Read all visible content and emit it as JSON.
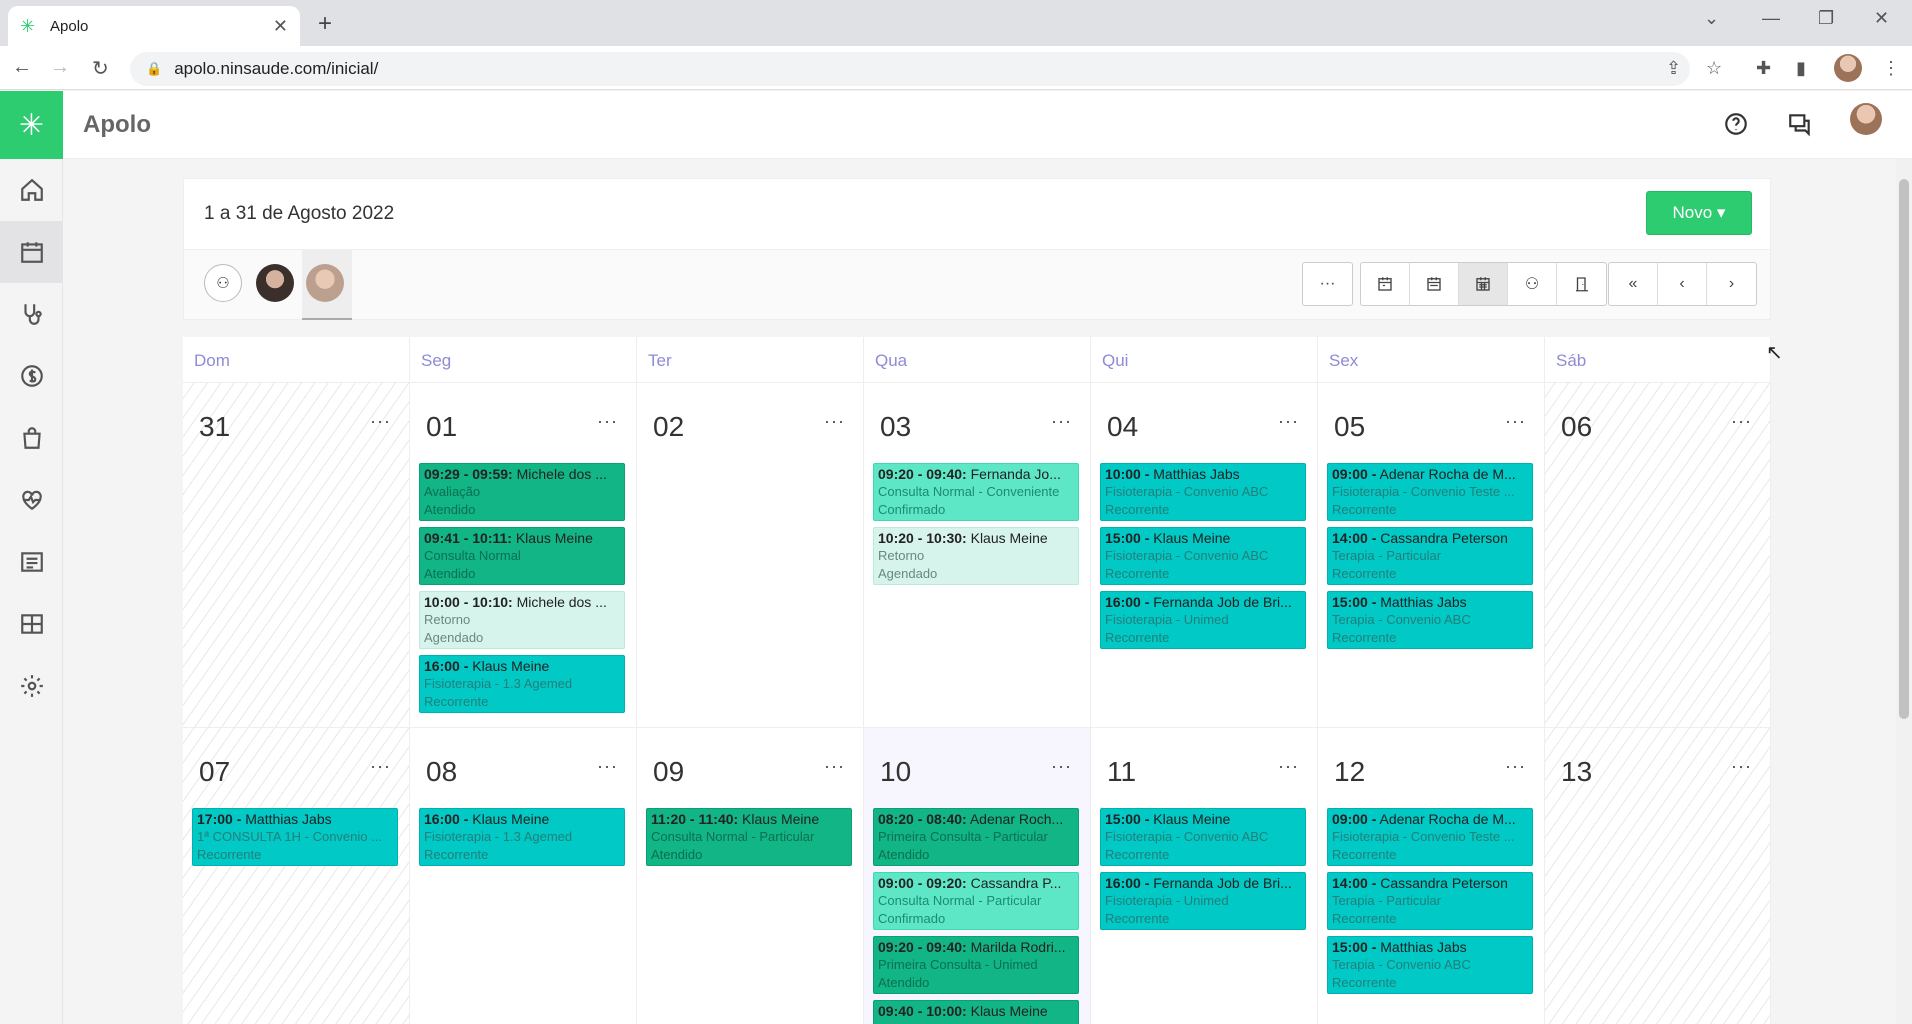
{
  "browser": {
    "tab_title": "Apolo",
    "url": "apolo.ninsaude.com/inicial/"
  },
  "app": {
    "brand": "Apolo",
    "period": "1 a 31 de Agosto 2022",
    "new_button": "Novo ▾",
    "accent": "#2ecc71"
  },
  "weekdays": [
    "Dom",
    "Seg",
    "Ter",
    "Qua",
    "Qui",
    "Sex",
    "Sáb"
  ],
  "weeks": [
    {
      "days": [
        {
          "num": "31",
          "weekend": true,
          "events": []
        },
        {
          "num": "01",
          "events": [
            {
              "time": "09:29 - 09:59:",
              "name": "Michele dos ...",
              "type": "Avaliação",
              "status": "Atendido",
              "color": "green"
            },
            {
              "time": "09:41 - 10:11:",
              "name": "Klaus Meine",
              "type": "Consulta Normal",
              "status": "Atendido",
              "color": "green"
            },
            {
              "time": "10:00 - 10:10:",
              "name": "Michele dos ...",
              "type": "Retorno",
              "status": "Agendado",
              "color": "pale"
            },
            {
              "time": "16:00 -",
              "name": "Klaus Meine",
              "type": "Fisioterapia - 1.3 Agemed",
              "status": "Recorrente",
              "color": "cyan"
            }
          ]
        },
        {
          "num": "02",
          "events": []
        },
        {
          "num": "03",
          "events": [
            {
              "time": "09:20 - 09:40:",
              "name": "Fernanda Jo...",
              "type": "Consulta Normal - Conveniente",
              "status": "Confirmado",
              "color": "light"
            },
            {
              "time": "10:20 - 10:30:",
              "name": "Klaus Meine",
              "type": "Retorno",
              "status": "Agendado",
              "color": "pale"
            }
          ]
        },
        {
          "num": "04",
          "events": [
            {
              "time": "10:00 -",
              "name": "Matthias Jabs",
              "type": "Fisioterapia - Convenio ABC",
              "status": "Recorrente",
              "color": "cyan"
            },
            {
              "time": "15:00 -",
              "name": "Klaus Meine",
              "type": "Fisioterapia - Convenio ABC",
              "status": "Recorrente",
              "color": "cyan"
            },
            {
              "time": "16:00 -",
              "name": "Fernanda Job de Bri...",
              "type": "Fisioterapia - Unimed",
              "status": "Recorrente",
              "color": "cyan"
            }
          ]
        },
        {
          "num": "05",
          "events": [
            {
              "time": "09:00 -",
              "name": "Adenar Rocha de M...",
              "type": "Fisioterapia - Convenio Teste ...",
              "status": "Recorrente",
              "color": "cyan"
            },
            {
              "time": "14:00 -",
              "name": "Cassandra Peterson",
              "type": "Terapia - Particular",
              "status": "Recorrente",
              "color": "cyan"
            },
            {
              "time": "15:00 -",
              "name": "Matthias Jabs",
              "type": "Terapia - Convenio ABC",
              "status": "Recorrente",
              "color": "cyan"
            }
          ]
        },
        {
          "num": "06",
          "weekend": true,
          "events": []
        }
      ]
    },
    {
      "days": [
        {
          "num": "07",
          "weekend": true,
          "events": [
            {
              "time": "17:00 -",
              "name": "Matthias Jabs",
              "type": "1ª CONSULTA 1H - Convenio ...",
              "status": "Recorrente",
              "color": "cyan"
            }
          ]
        },
        {
          "num": "08",
          "events": [
            {
              "time": "16:00 -",
              "name": "Klaus Meine",
              "type": "Fisioterapia - 1.3 Agemed",
              "status": "Recorrente",
              "color": "cyan"
            }
          ]
        },
        {
          "num": "09",
          "events": [
            {
              "time": "11:20 - 11:40:",
              "name": "Klaus Meine",
              "type": "Consulta Normal - Particular",
              "status": "Atendido",
              "color": "green"
            }
          ]
        },
        {
          "num": "10",
          "today": true,
          "events": [
            {
              "time": "08:20 - 08:40:",
              "name": "Adenar Roch...",
              "type": "Primeira Consulta - Particular",
              "status": "Atendido",
              "color": "green"
            },
            {
              "time": "09:00 - 09:20:",
              "name": "Cassandra P...",
              "type": "Consulta Normal - Particular",
              "status": "Confirmado",
              "color": "light"
            },
            {
              "time": "09:20 - 09:40:",
              "name": "Marilda Rodri...",
              "type": "Primeira Consulta - Unimed",
              "status": "Atendido",
              "color": "green"
            },
            {
              "time": "09:40 - 10:00:",
              "name": "Klaus Meine",
              "type": "",
              "status": "",
              "color": "green"
            }
          ]
        },
        {
          "num": "11",
          "events": [
            {
              "time": "15:00 -",
              "name": "Klaus Meine",
              "type": "Fisioterapia - Convenio ABC",
              "status": "Recorrente",
              "color": "cyan"
            },
            {
              "time": "16:00 -",
              "name": "Fernanda Job de Bri...",
              "type": "Fisioterapia - Unimed",
              "status": "Recorrente",
              "color": "cyan"
            }
          ]
        },
        {
          "num": "12",
          "events": [
            {
              "time": "09:00 -",
              "name": "Adenar Rocha de M...",
              "type": "Fisioterapia - Convenio Teste ...",
              "status": "Recorrente",
              "color": "cyan"
            },
            {
              "time": "14:00 -",
              "name": "Cassandra Peterson",
              "type": "Terapia - Particular",
              "status": "Recorrente",
              "color": "cyan"
            },
            {
              "time": "15:00 -",
              "name": "Matthias Jabs",
              "type": "Terapia - Convenio ABC",
              "status": "Recorrente",
              "color": "cyan"
            }
          ]
        },
        {
          "num": "13",
          "weekend": true,
          "events": []
        }
      ]
    }
  ]
}
